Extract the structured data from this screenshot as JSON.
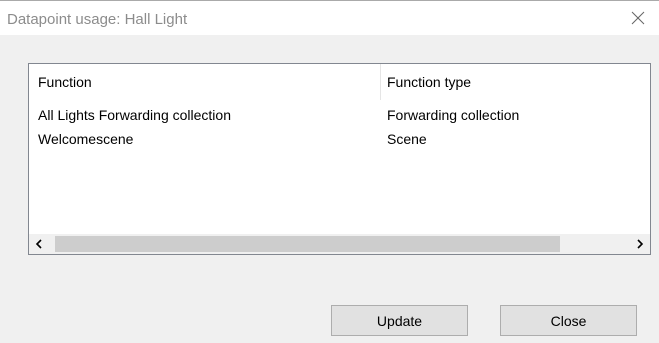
{
  "dialog": {
    "title": "Datapoint usage: Hall Light",
    "close_icon": "close-icon"
  },
  "list": {
    "columns": [
      "Function",
      "Function type"
    ],
    "rows": [
      [
        "All Lights Forwarding collection",
        "Forwarding collection"
      ],
      [
        "Welcomescene",
        "Scene"
      ]
    ],
    "scrollbar": {
      "left_icon": "chevron-left-icon",
      "right_icon": "chevron-right-icon"
    }
  },
  "buttons": {
    "update_label": "Update",
    "close_label": "Close"
  }
}
